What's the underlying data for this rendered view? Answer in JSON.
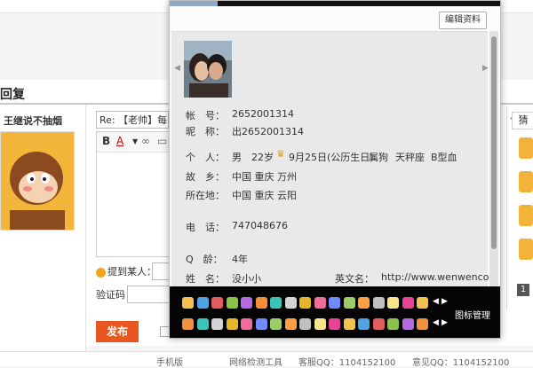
{
  "background": {
    "reply_title": "回复",
    "user_name": "王继说不抽烟",
    "subject_value": "Re: 【老帅】每日一",
    "editor_toolbar": {
      "bold": "B",
      "font_color": "A",
      "link": "∞"
    },
    "mention_label": "提到某人：",
    "captcha_label": "验证码：",
    "publish_label": "发布",
    "footer": {
      "item1": "手机版",
      "item2": "网络检测工具",
      "item3": "客服QQ：1104152100",
      "item4": "意见QQ：1104152100"
    },
    "right_tab_label": "猜",
    "right_page_number": "1"
  },
  "popup": {
    "edit_button": "编辑资料",
    "account_label": "帐　号：",
    "account_value": "2652001314",
    "nickname_label": "昵　称：",
    "nickname_value": "出2652001314",
    "personal_label": "个　人：",
    "gender": "男",
    "age": "22岁",
    "birthday": "9月25日(公历生日)",
    "zodiac": "属狗",
    "star_sign": "天秤座",
    "blood_type": "B型血",
    "hometown_label": "故　乡：",
    "hometown_value": "中国 重庆 万州",
    "location_label": "所在地：",
    "location_value": "中国 重庆 云阳",
    "phone_label": "电　话：",
    "phone_value": "747048676",
    "qq_age_label": "Q　龄：",
    "qq_age_value": "4年",
    "name_label": "姓　名：",
    "name_value": "没小小",
    "en_name_label": "英文名：",
    "en_name_value": "http://www.wenwencom",
    "icon_manage": "图标管理"
  },
  "colors": {
    "publish": "#e9561f",
    "popup_info_bg": "#e9e9e9",
    "icon_strip_bg": "#050505"
  }
}
